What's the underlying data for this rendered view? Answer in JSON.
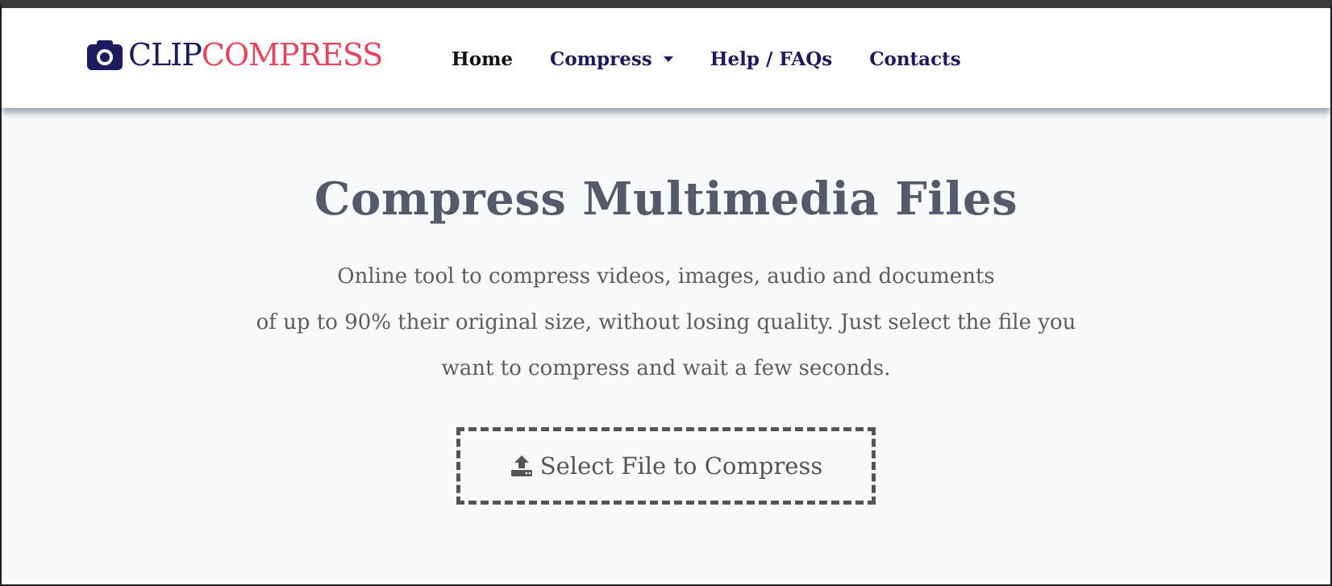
{
  "brand": {
    "icon": "camera-icon",
    "name_part1": "CLIP",
    "name_part2": "COMPRESS",
    "color_primary": "#1c1b5e",
    "color_accent": "#e2475f"
  },
  "nav": {
    "items": [
      {
        "label": "Home",
        "active": true
      },
      {
        "label": "Compress",
        "has_dropdown": true,
        "icon": "caret-down-icon"
      },
      {
        "label": "Help / FAQs"
      },
      {
        "label": "Contacts"
      }
    ]
  },
  "hero": {
    "title": "Compress Multimedia Files",
    "desc_lines": [
      "Online tool to compress videos, images, audio and documents",
      "of up to 90% their original size, without losing quality. Just select the file you",
      "want to compress and wait a few seconds."
    ],
    "upload": {
      "icon": "upload-icon",
      "label": "Select File to Compress"
    }
  }
}
